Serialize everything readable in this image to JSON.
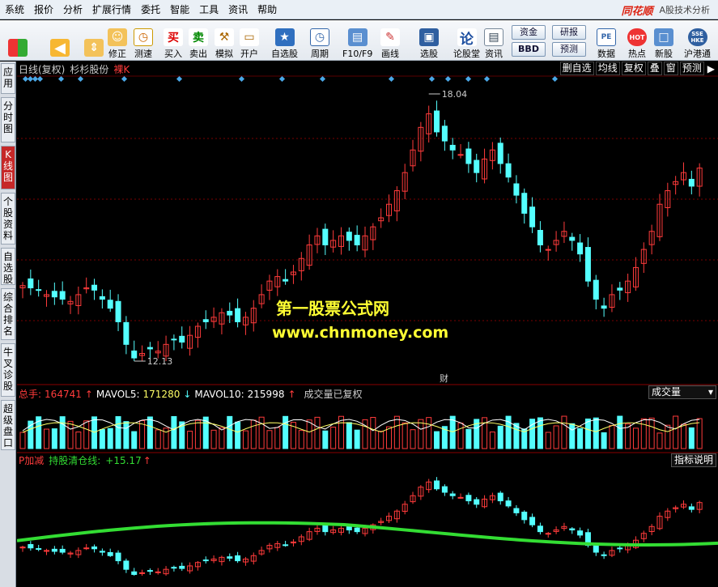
{
  "menu": {
    "items": [
      "系统",
      "报价",
      "分析",
      "扩展行情",
      "委托",
      "智能",
      "工具",
      "资讯",
      "帮助"
    ],
    "brand": "同花顺",
    "subtitle": "A股技术分析"
  },
  "toolbar": {
    "left": [
      {
        "label": "修正"
      },
      {
        "label": "测速"
      },
      {
        "label": "买入"
      },
      {
        "label": "卖出"
      },
      {
        "label": "模拟"
      },
      {
        "label": "开户"
      },
      {
        "label": "自选股"
      },
      {
        "label": "周期"
      },
      {
        "label": "F10/F9"
      },
      {
        "label": "画线"
      },
      {
        "label": "选股"
      },
      {
        "label": "论股堂"
      },
      {
        "label": "资讯"
      }
    ],
    "badges": [
      "资金",
      "BBD",
      "研报",
      "预测"
    ],
    "right": [
      {
        "label": "数据"
      },
      {
        "label": "热点"
      },
      {
        "label": "新股"
      },
      {
        "label": "沪港通"
      }
    ],
    "icon_text": {
      "buy": "买",
      "sell": "卖",
      "pe": "PE",
      "hot": "HOT",
      "shhk": "SSE HKE",
      "lun": "论"
    }
  },
  "lefttabs": [
    "应用",
    "分时图",
    "K线图",
    "个股资料",
    "自选股",
    "综合排名",
    "牛叉诊股",
    "超级盘口"
  ],
  "chart": {
    "header": {
      "period": "日线(复权)",
      "stock": "杉杉股份",
      "mode": "裸K"
    },
    "buttons": [
      "删自选",
      "均线",
      "复权",
      "叠",
      "窗",
      "预测"
    ],
    "high_label": "18.04",
    "low_label": "12.13",
    "finance_marker": "财",
    "watermark_line1": "第一股票公式网",
    "watermark_line2": "www.chnmoney.com",
    "volume": {
      "label": "总手:",
      "value": "164741",
      "mavol5_label": "MAVOL5:",
      "mavol5": "171280",
      "mavol10_label": "MAVOL10:",
      "mavol10": "215998",
      "note": "成交量已复权",
      "dropdown": "成交量"
    },
    "indicator": {
      "name": "P加减",
      "line_label": "持股清仓线:",
      "line_value": "+15.17",
      "help": "指标说明"
    },
    "colors": {
      "up": "#ff3b3b",
      "down": "#54ffff",
      "line": "#33dd33",
      "ma5": "#ffffff",
      "ma10": "#ffff66",
      "grid": "#7a0000"
    }
  },
  "chart_data": {
    "type": "candlestick",
    "price_high": 18.04,
    "price_low": 12.13,
    "closes": [
      13.8,
      13.75,
      13.7,
      13.6,
      13.55,
      13.5,
      13.45,
      13.6,
      13.75,
      13.7,
      13.5,
      13.3,
      13.0,
      12.5,
      12.2,
      12.3,
      12.4,
      12.35,
      12.5,
      12.6,
      12.55,
      12.7,
      12.9,
      13.0,
      13.1,
      13.2,
      13.15,
      13.0,
      13.1,
      13.3,
      13.6,
      13.9,
      14.0,
      13.9,
      14.1,
      14.4,
      14.7,
      14.9,
      14.7,
      14.8,
      14.9,
      14.8,
      14.7,
      14.9,
      15.1,
      15.3,
      15.6,
      15.9,
      16.3,
      16.8,
      17.3,
      17.6,
      17.2,
      17.0,
      16.8,
      16.7,
      16.5,
      16.3,
      16.6,
      16.8,
      16.5,
      16.2,
      15.8,
      15.4,
      15.1,
      14.7,
      14.6,
      14.8,
      15.0,
      14.8,
      14.5,
      13.9,
      13.5,
      13.3,
      13.6,
      13.7,
      13.9,
      14.2,
      14.6,
      15.0,
      15.6,
      15.9,
      16.1,
      16.3,
      16.0,
      16.4
    ]
  }
}
